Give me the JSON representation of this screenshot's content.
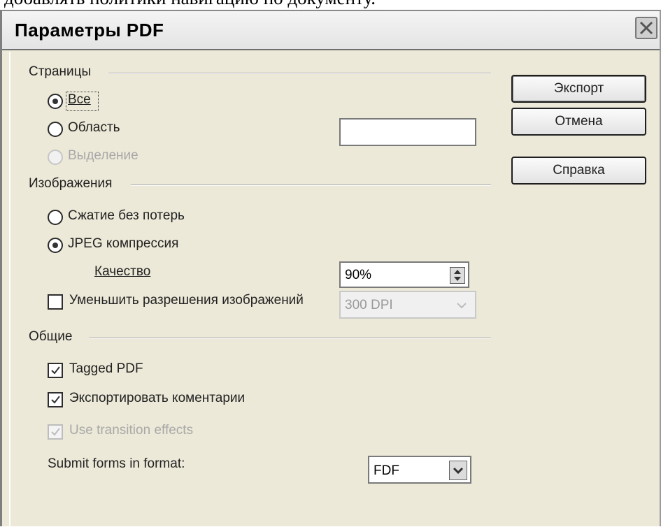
{
  "doc_caption": "добавлять политики навигацию по документу.",
  "dialog": {
    "title": "Параметры PDF"
  },
  "buttons": {
    "export": "Экспорт",
    "cancel": "Отмена",
    "help": "Справка"
  },
  "pages": {
    "group": "Страницы",
    "all": "Все",
    "range": "Область",
    "range_value": "",
    "selection": "Выделение",
    "selected": "all"
  },
  "images": {
    "group": "Изображения",
    "lossless": "Сжатие без потерь",
    "jpeg": "JPEG компрессия",
    "quality_label": "Качество",
    "quality_value": "90%",
    "reduce_label": "Уменьшить разрешения изображений",
    "reduce_checked": false,
    "resolution_value": "300 DPI",
    "selected": "jpeg"
  },
  "general": {
    "group": "Общие",
    "tagged_pdf": "Tagged PDF",
    "tagged_checked": true,
    "export_notes": "Экспортировать коментарии",
    "notes_checked": true,
    "transition": "Use transition effects",
    "transition_checked": true,
    "submit_label": "Submit forms in format:",
    "submit_value": "FDF"
  }
}
